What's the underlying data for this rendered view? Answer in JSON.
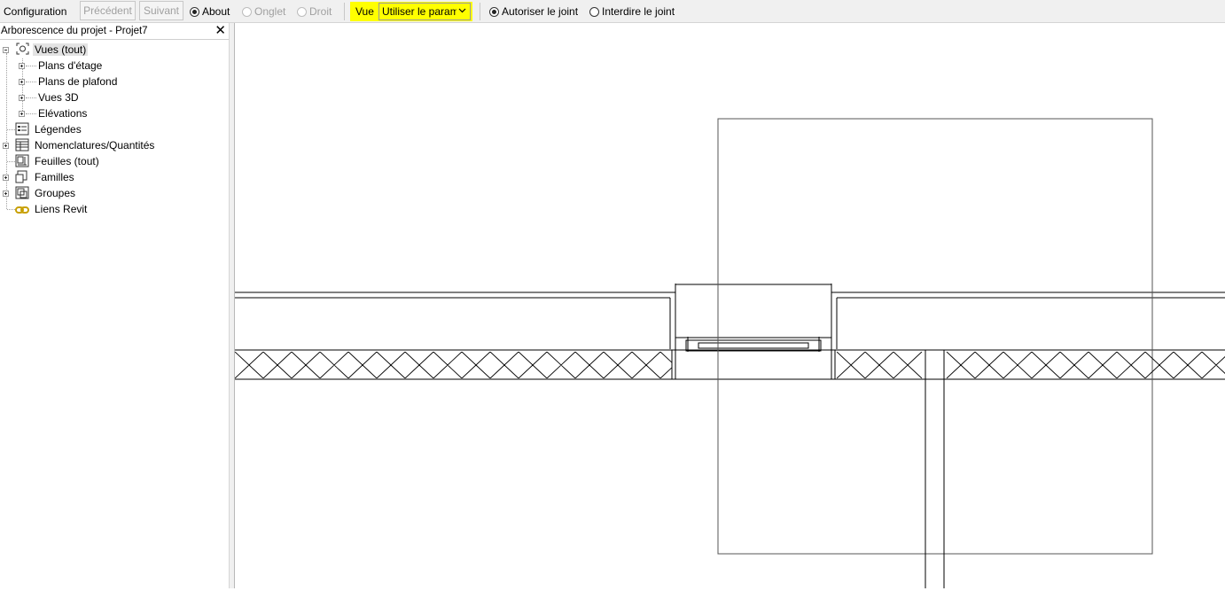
{
  "options_bar": {
    "configuration": "Configuration",
    "previous": "Précédent",
    "next": "Suivant",
    "radio_about": "About",
    "radio_onglet": "Onglet",
    "radio_droit": "Droit",
    "vue_label": "Vue",
    "vue_select_value": "Utiliser le paramètre",
    "allow_join": "Autoriser le joint",
    "forbid_join": "Interdire le joint",
    "highlight_color": "#ffff00"
  },
  "project_browser": {
    "title": "Arborescence du projet - Projet7",
    "close_icon": "close-icon",
    "root": "Vues (tout)",
    "views": [
      "Plans d'étage",
      "Plans de plafond",
      "Vues 3D",
      "Elévations"
    ],
    "legends": "Légendes",
    "schedules": "Nomenclatures/Quantités",
    "sheets": "Feuilles (tout)",
    "families": "Familles",
    "groups": "Groupes",
    "links": "Liens Revit"
  }
}
